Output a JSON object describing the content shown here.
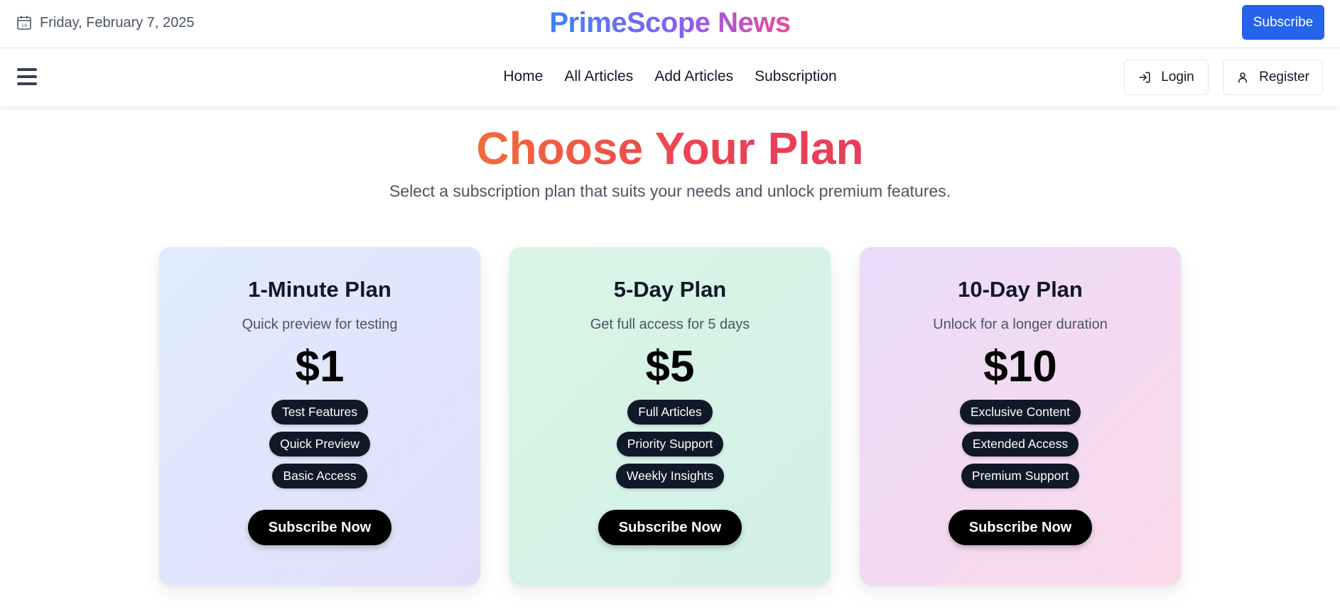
{
  "topbar": {
    "date": "Friday, February 7, 2025",
    "calendar_icon": "calendar-icon",
    "brand": "PrimeScope News",
    "subscribe_label": "Subscribe",
    "colors": {
      "subscribe_bg": "#2563eb",
      "brand_gradient": [
        "#3b82f6",
        "#8b5cf6",
        "#ec4899"
      ]
    }
  },
  "nav": {
    "menu_icon": "hamburger-menu-icon",
    "links": [
      {
        "label": "Home"
      },
      {
        "label": "All Articles"
      },
      {
        "label": "Add Articles"
      },
      {
        "label": "Subscription"
      }
    ],
    "login_label": "Login",
    "login_icon": "login-arrow-icon",
    "register_label": "Register",
    "register_icon": "user-icon"
  },
  "hero": {
    "title": "Choose Your Plan",
    "subtitle": "Select a subscription plan that suits your needs and unlock premium features.",
    "title_gradient": [
      "#f26b3a",
      "#e63e5c"
    ]
  },
  "plans": [
    {
      "name": "1-Minute Plan",
      "description": "Quick preview for testing",
      "price": "$1",
      "features": [
        "Test Features",
        "Quick Preview",
        "Basic Access"
      ],
      "cta": "Subscribe Now",
      "colors": [
        "#e0ecfd",
        "#e1defb"
      ]
    },
    {
      "name": "5-Day Plan",
      "description": "Get full access for 5 days",
      "price": "$5",
      "features": [
        "Full Articles",
        "Priority Support",
        "Weekly Insights"
      ],
      "cta": "Subscribe Now",
      "colors": [
        "#d9f5e5",
        "#d2f0e8"
      ]
    },
    {
      "name": "10-Day Plan",
      "description": "Unlock for a longer duration",
      "price": "$10",
      "features": [
        "Exclusive Content",
        "Extended Access",
        "Premium Support"
      ],
      "cta": "Subscribe Now",
      "colors": [
        "#eadcfa",
        "#fbd9ea"
      ]
    }
  ]
}
